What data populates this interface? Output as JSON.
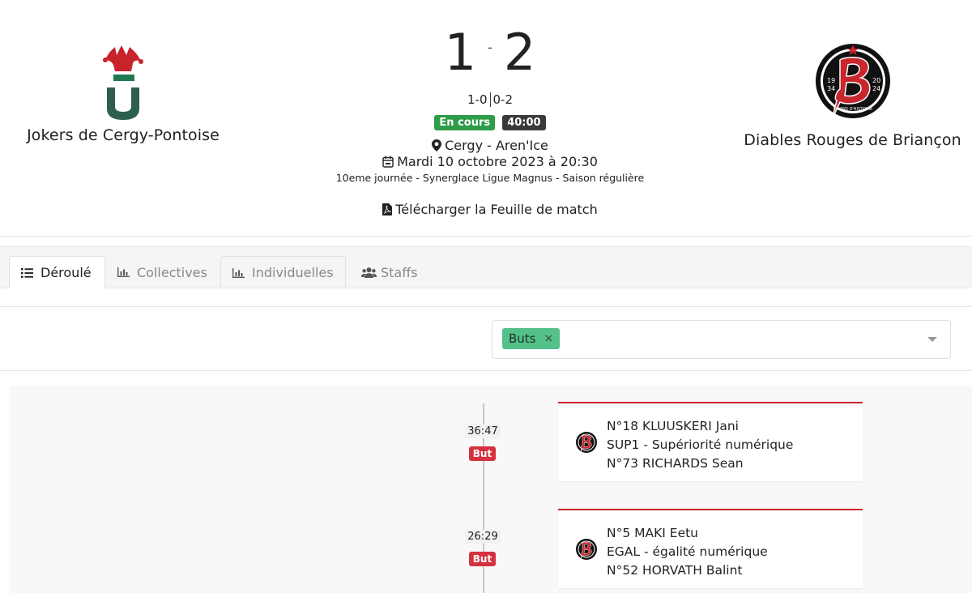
{
  "match": {
    "home_team": "Jokers de Cergy-Pontoise",
    "away_team": "Diables Rouges de Briançon",
    "home_score": "1",
    "score_separator": "-",
    "away_score": "2",
    "periods": [
      "1-0",
      "0-2"
    ],
    "status": "En cours",
    "clock": "40:00",
    "venue": "Cergy - Aren'Ice",
    "date": "Mardi 10 octobre 2023 à 20:30",
    "competition": "10eme journée - Synerglace Ligue Magnus - Saison régulière",
    "download_label": "Télécharger la Feuille de match",
    "away_logo_text": {
      "year_left_top": "19",
      "year_left_bottom": "34",
      "year_right_top": "20",
      "year_right_bottom": "24",
      "motto": "90 ANS D'HISTOIRE"
    }
  },
  "tabs": [
    {
      "label": "Déroulé",
      "icon": "list-icon"
    },
    {
      "label": "Collectives",
      "icon": "bar-chart-icon"
    },
    {
      "label": "Individuelles",
      "icon": "bar-chart-icon"
    },
    {
      "label": "Staffs",
      "icon": "users-icon"
    }
  ],
  "filter": {
    "selected_chip": "Buts",
    "chip_remove": "×"
  },
  "events": [
    {
      "time": "36:47",
      "type": "But",
      "scorer": "N°18 KLUUSKERI Jani",
      "situation": "SUP1 - Supériorité numérique",
      "assist": "N°73 RICHARDS Sean"
    },
    {
      "time": "26:29",
      "type": "But",
      "scorer": "N°5 MAKI Eetu",
      "situation": "EGAL - égalité numérique",
      "assist": "N°52 HORVATH Balint"
    }
  ],
  "colors": {
    "status_green": "#2e9c49",
    "clock_dark": "#3a3a3a",
    "chip_green": "#54c08a",
    "goal_red": "#d5323f",
    "card_border_red": "#c9262e",
    "home_logo_red": "#c8222b",
    "home_logo_green": "#1f7a52"
  }
}
